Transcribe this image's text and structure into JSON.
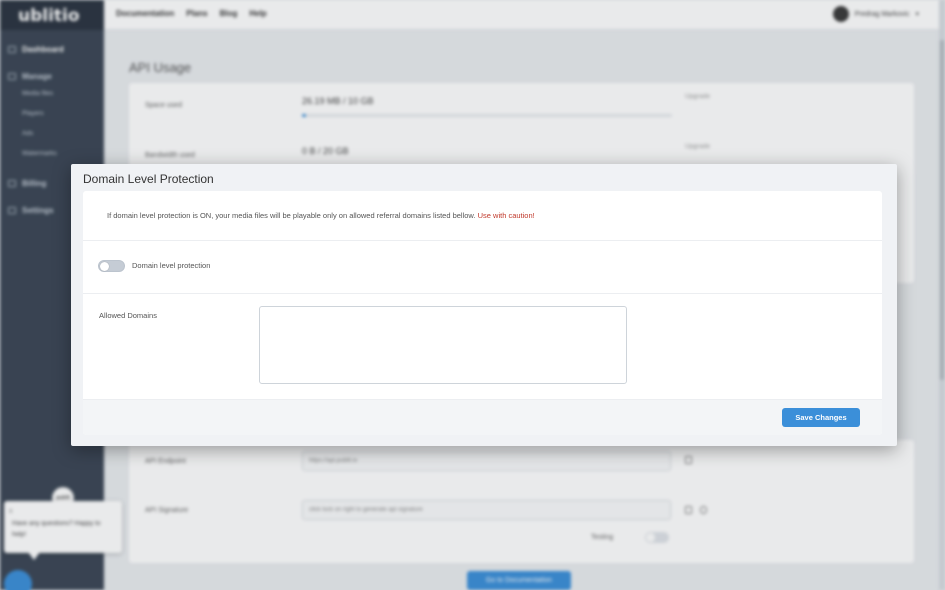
{
  "app": {
    "logo": "ublitio"
  },
  "sidebar": {
    "items": [
      {
        "label": "Dashboard",
        "icon": "home-icon"
      },
      {
        "label": "Manage",
        "icon": "list-icon"
      },
      {
        "label": "Media files"
      },
      {
        "label": "Players"
      },
      {
        "label": "Ads"
      },
      {
        "label": "Watermarks"
      },
      {
        "label": "Billing",
        "icon": "card-icon"
      },
      {
        "label": "Settings",
        "icon": "gear-icon"
      }
    ]
  },
  "topnav": {
    "links": [
      "Documentation",
      "Plans",
      "Blog",
      "Help"
    ]
  },
  "user": {
    "name": "Predrag Markovic"
  },
  "api_usage": {
    "title": "API Usage",
    "space": {
      "label": "Space used",
      "value": "26.19 MB / 10 GB",
      "upgrade": "Upgrade",
      "progress": 0.003
    },
    "bandwidth": {
      "label": "Bandwidth used",
      "value": "0 B / 20 GB",
      "upgrade": "Upgrade"
    }
  },
  "api": {
    "endpoint_label": "API Endpoint",
    "endpoint_value": "https://api.publit.io",
    "signature_label": "API Signature",
    "signature_placeholder": "click lock on right to generate api signature",
    "testing_label": "Testing",
    "docs_button": "Go to Documentation"
  },
  "chat": {
    "close": "x",
    "message": "Have any questions? Happy to help!",
    "avatar_text": "publit"
  },
  "modal": {
    "title": "Domain Level Protection",
    "notice": "If domain level protection is ON, your media files will be playable only on allowed referral domains listed bellow.",
    "caution": "Use with caution!",
    "toggle_label": "Domain level protection",
    "toggle_on": false,
    "domains_label": "Allowed Domains",
    "domains_value": "",
    "save_button": "Save Changes"
  },
  "colors": {
    "accent": "#3b8fd9",
    "sidebar": "#3b4655",
    "caution": "#c0392b"
  }
}
